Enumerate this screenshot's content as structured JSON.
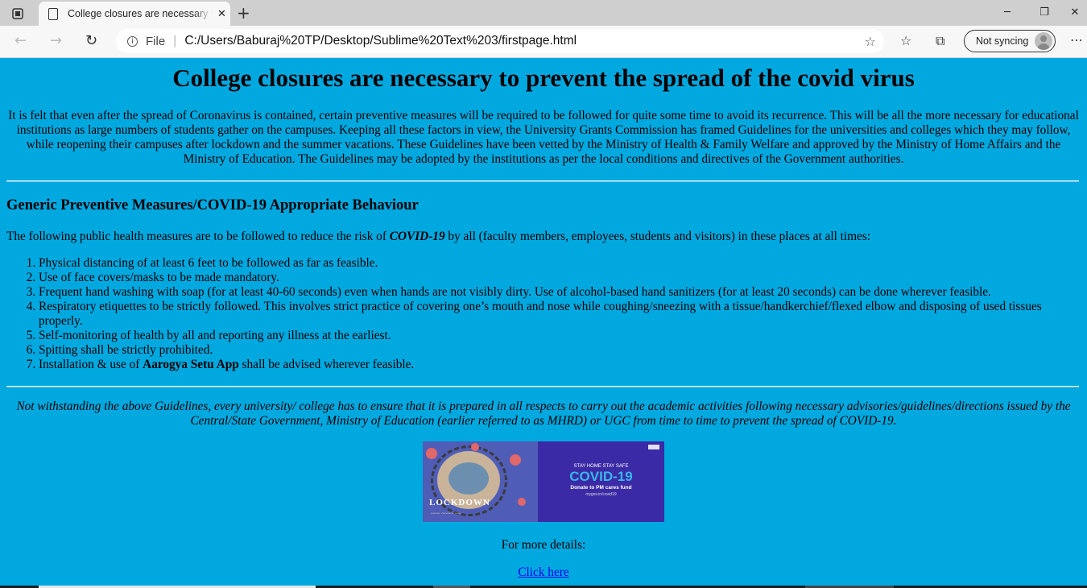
{
  "browser": {
    "tab_title": "College closures are necessary to prevent the spread of the covid virus",
    "address_scheme": "File",
    "url": "C:/Users/Baburaj%20TP/Desktop/Sublime%20Text%203/firstpage.html",
    "sync_label": "Not syncing"
  },
  "page": {
    "heading": "College closures are necessary to prevent the spread of the covid virus",
    "intro": "It is felt that even after the spread of Coronavirus is contained, certain preventive measures will be required to be followed for quite some time to avoid its recurrence. This will be all the more necessary for educational institutions as large numbers of students gather on the campuses. Keeping all these factors in view, the University Grants Commission has framed Guidelines for the universities and colleges which they may follow, while reopening their campuses after lockdown and the summer vacations. These Guidelines have been vetted by the Ministry of Health & Family Welfare and approved by the Ministry of Home Affairs and the Ministry of Education. The Guidelines may be adopted by the institutions as per the local conditions and directives of the Government authorities.",
    "section_heading": "Generic Preventive Measures/COVID-19 Appropriate Behaviour",
    "lead_before": "The following public health measures are to be followed to reduce the risk of ",
    "lead_em": "COVID-19",
    "lead_after": " by all (faculty members, employees, students and visitors) in these places at all times:",
    "measures": [
      "Physical distancing of at least 6 feet to be followed as far as feasible.",
      "Use of face covers/masks to be made mandatory.",
      "Frequent hand washing with soap (for at least 40-60 seconds) even when hands are not visibly dirty. Use of alcohol-based hand sanitizers (for at least 20 seconds) can be done wherever feasible.",
      "Respiratory etiquettes to be strictly followed. This involves strict practice of covering one’s mouth and nose while coughing/sneezing with a tissue/handkerchief/flexed elbow and disposing of used tissues properly.",
      "Self-monitoring of health by all and reporting any illness at the earliest.",
      "Spitting shall be strictly prohibited."
    ],
    "measure7_before": "Installation & use of ",
    "measure7_bold": "Aarogya Setu App",
    "measure7_after": " shall be advised wherever feasible.",
    "note": "Not withstanding the above Guidelines, every university/ college has to ensure that it is prepared in all respects to carry out the academic activities following necessary advisories/guidelines/directions issued by the Central/State Government, Ministry of Education (earlier referred to as MHRD) or UGC from time to time to prevent the spread of COVID-19.",
    "banner": {
      "left_text": "LOCKDOWN",
      "top_text": "STAY HOME STAY SAFE",
      "main_text": "COVID-19",
      "donate_text": "Donate to PM cares fund",
      "fund_text": "mygov.in/covid19"
    },
    "more_details": "For more details:",
    "link_text": "Click here"
  }
}
